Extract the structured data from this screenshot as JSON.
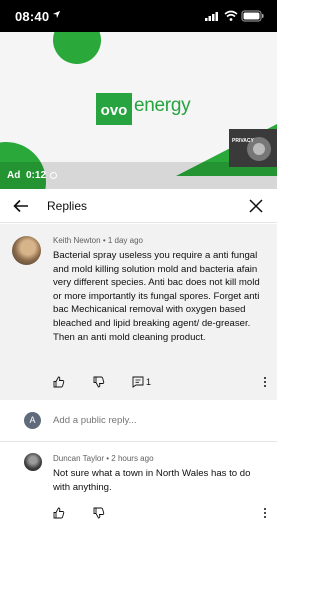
{
  "status_bar": {
    "time": "08:40"
  },
  "video": {
    "logo_text": "energy",
    "ad_label": "Ad",
    "ad_time": "0:12",
    "thumbnail_text": "PRIVACY"
  },
  "header": {
    "title": "Replies"
  },
  "main_comment": {
    "author": "Keith Newton",
    "time": "1 day ago",
    "text": "Bacterial spray useless you require a anti fungal and mold killing solution  mold and bacteria afain very different  species. Anti bac does not kill mold or more importantly its fungal spores. Forget anti bac Mechicanical removal   with oxygen based bleached and lipid breaking agent/ de-greaser. Then an anti mold cleaning product.",
    "reply_count": "1"
  },
  "reply_box": {
    "avatar_letter": "A",
    "placeholder": "Add a public reply..."
  },
  "replies": [
    {
      "author": "Duncan Taylor",
      "time": "2 hours ago",
      "text": "Not sure what a town in North Wales has to do with anything."
    }
  ],
  "colors": {
    "brand_green": "#27a33f",
    "ad_green": "#2aa83a"
  }
}
